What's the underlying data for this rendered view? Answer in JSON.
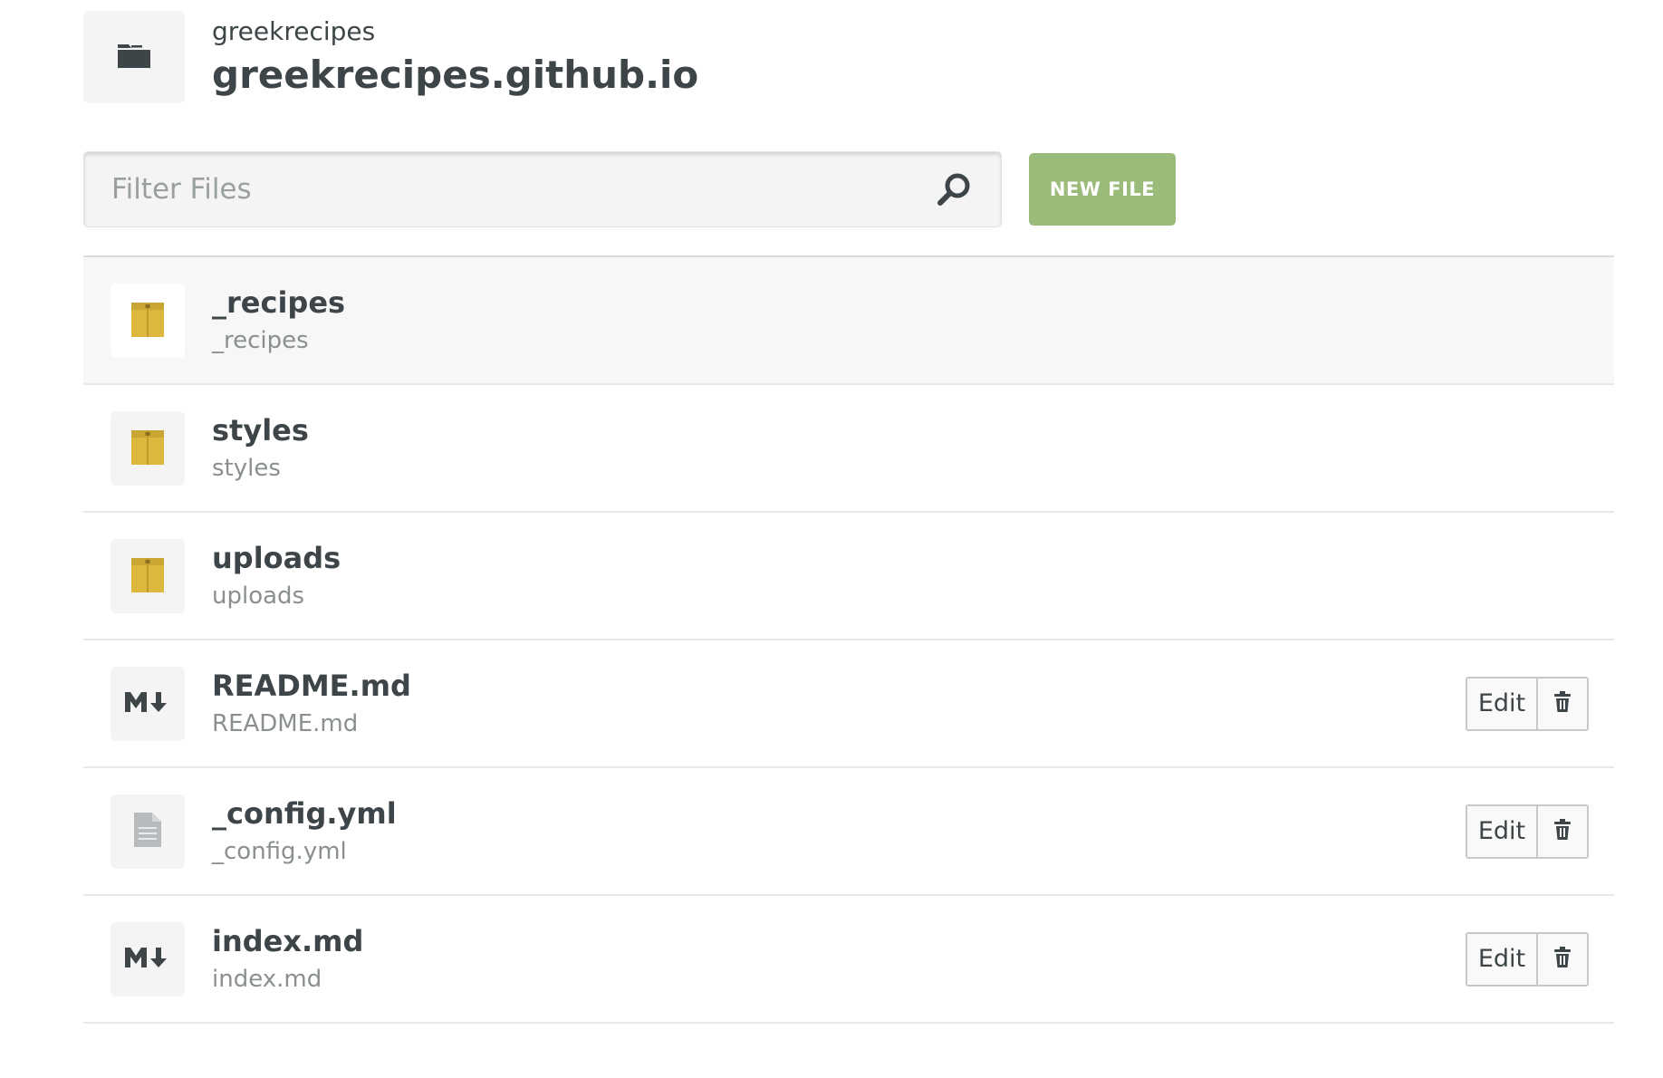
{
  "repo": {
    "owner": "greekrecipes",
    "name": "greekrecipes.github.io",
    "icon": "folder-icon"
  },
  "toolbar": {
    "filter_placeholder": "Filter Files",
    "filter_value": "",
    "search_icon": "search-icon",
    "new_file_label": "NEW FILE",
    "new_file_color": "#9bbb7a"
  },
  "files": [
    {
      "name": "_recipes",
      "path": "_recipes",
      "type": "folder",
      "icon": "folder-icon",
      "active": true
    },
    {
      "name": "styles",
      "path": "styles",
      "type": "folder",
      "icon": "folder-icon",
      "active": false
    },
    {
      "name": "uploads",
      "path": "uploads",
      "type": "folder",
      "icon": "folder-icon",
      "active": false
    },
    {
      "name": "README.md",
      "path": "README.md",
      "type": "markdown",
      "icon": "markdown-icon",
      "edit_label": "Edit",
      "active": false
    },
    {
      "name": "_config.yml",
      "path": "_config.yml",
      "type": "file",
      "icon": "document-icon",
      "edit_label": "Edit",
      "active": false
    },
    {
      "name": "index.md",
      "path": "index.md",
      "type": "markdown",
      "icon": "markdown-icon",
      "edit_label": "Edit",
      "active": false
    }
  ],
  "colors": {
    "folder": "#dcb83f",
    "folder_dark": "#bf9c2b",
    "text": "#3d4548",
    "muted": "#8a8f91"
  }
}
